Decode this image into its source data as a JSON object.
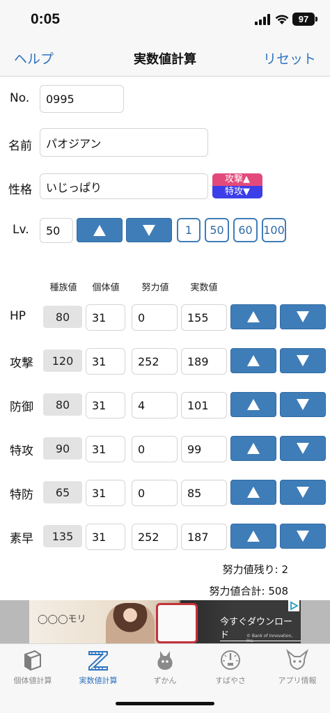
{
  "status": {
    "time": "0:05",
    "battery": "97"
  },
  "nav": {
    "help": "ヘルプ",
    "title": "実数値計算",
    "reset": "リセット"
  },
  "form": {
    "no_label": "No.",
    "no_value": "0995",
    "name_label": "名前",
    "name_value": "パオジアン",
    "nature_label": "性格",
    "nature_value": "いじっぱり",
    "nature_up": "攻撃▲",
    "nature_down": "特攻▼",
    "lv_label": "Lv.",
    "lv_value": "50",
    "lv_presets": [
      "1",
      "50",
      "60",
      "100"
    ]
  },
  "columns": {
    "base": "種族値",
    "iv": "個体値",
    "ev": "努力値",
    "actual": "実数値"
  },
  "stats": [
    {
      "label": "HP",
      "base": "80",
      "iv": "31",
      "ev": "0",
      "actual": "155"
    },
    {
      "label": "攻撃",
      "base": "120",
      "iv": "31",
      "ev": "252",
      "actual": "189"
    },
    {
      "label": "防御",
      "base": "80",
      "iv": "31",
      "ev": "4",
      "actual": "101"
    },
    {
      "label": "特攻",
      "base": "90",
      "iv": "31",
      "ev": "0",
      "actual": "99"
    },
    {
      "label": "特防",
      "base": "65",
      "iv": "31",
      "ev": "0",
      "actual": "85"
    },
    {
      "label": "素早",
      "base": "135",
      "iv": "31",
      "ev": "252",
      "actual": "187"
    }
  ],
  "summary": {
    "remaining": "努力値残り: 2",
    "total": "努力値合計: 508"
  },
  "ad": {
    "logo": "◯◯◯モリ",
    "cta": "今すぐダウンロード",
    "copyright": "© Bank of Innovation, Inc."
  },
  "tabs": [
    {
      "label": "個体値計算",
      "icon": "cube-icon"
    },
    {
      "label": "実数値計算",
      "icon": "z-ruler-icon",
      "active": true
    },
    {
      "label": "ずかん",
      "icon": "monster-icon"
    },
    {
      "label": "すばやさ",
      "icon": "speedometer-icon"
    },
    {
      "label": "アプリ情報",
      "icon": "creature-icon"
    }
  ],
  "colors": {
    "accent": "#2f74c0",
    "button": "#3f7db8",
    "nature_up": "#e34a7c",
    "nature_down": "#3c3ee8"
  }
}
